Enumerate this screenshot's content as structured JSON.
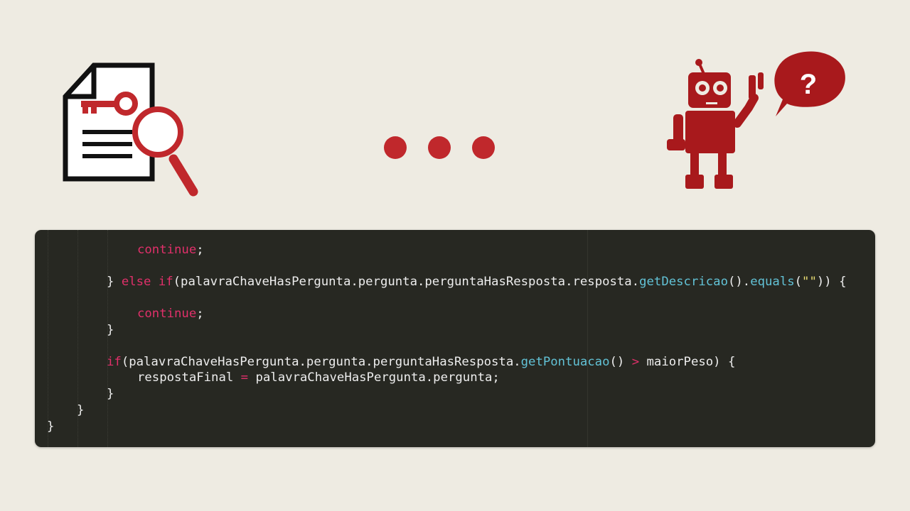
{
  "illustration": {
    "left_icon": "document-key-magnifier-icon",
    "middle_icon": "ellipsis-dots-icon",
    "right_icon": "robot-question-icon",
    "bubble_text": "?",
    "colors": {
      "accent": "#c0282c",
      "outline": "#111111",
      "background": "#eeebe2"
    }
  },
  "code": {
    "background": "#272822",
    "lines": {
      "l1": {
        "kw": "continue",
        "plain": ";"
      },
      "l2": {
        "brace": "} ",
        "kw1": "else",
        "kw2": "if",
        "p1": "(palavraChaveHasPergunta.pergunta.perguntaHasResposta.resposta.",
        "fn1": "getDescricao",
        "p2": "().",
        "fn2": "equals",
        "p3": "(",
        "str": "\"\"",
        "p4": ")) {"
      },
      "l3": {
        "kw": "continue",
        "plain": ";"
      },
      "l4": {
        "plain": "}"
      },
      "l5": {
        "kw": "if",
        "p1": "(palavraChaveHasPergunta.pergunta.perguntaHasResposta.",
        "fn": "getPontuacao",
        "p2": "() ",
        "op": ">",
        "p3": " maiorPeso) {"
      },
      "l6": {
        "p1": "respostaFinal ",
        "op": "=",
        "p2": " palavraChaveHasPergunta.pergunta;"
      },
      "l7": {
        "plain": "}"
      },
      "l8": {
        "plain": "}"
      },
      "l9": {
        "plain": "}"
      }
    }
  }
}
